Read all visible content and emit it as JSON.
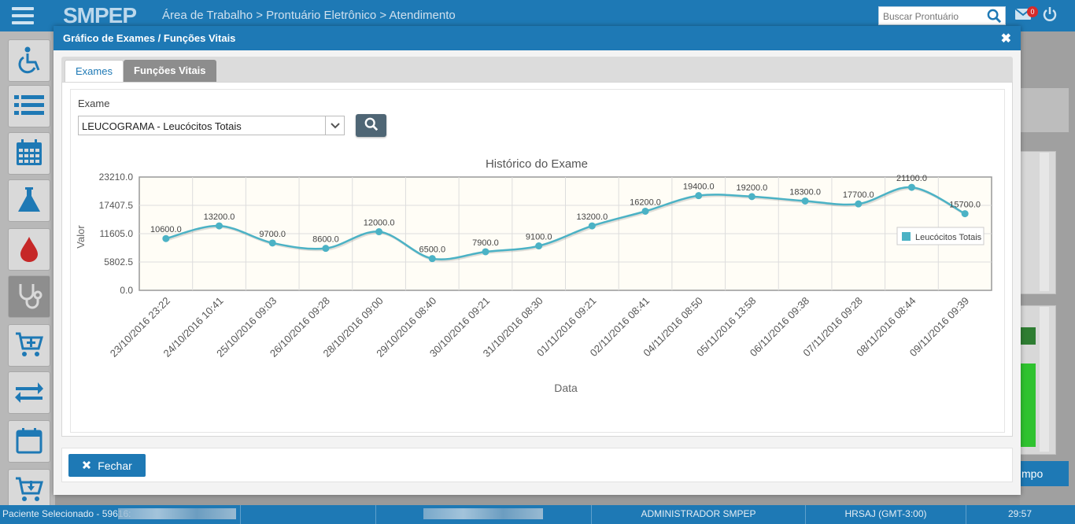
{
  "app": {
    "logo": "SMPEP",
    "breadcrumb": "Área de Trabalho > Prontuário Eletrônico > Atendimento",
    "search_placeholder": "Buscar Prontuário",
    "mail_badge": "0"
  },
  "sidebar": {
    "items": [
      {
        "icon": "accessibility-icon"
      },
      {
        "icon": "list-icon"
      },
      {
        "icon": "calendar-grid-icon"
      },
      {
        "icon": "flask-icon"
      },
      {
        "icon": "blood-drop-icon"
      },
      {
        "icon": "stethoscope-icon"
      },
      {
        "icon": "cart-add-icon"
      },
      {
        "icon": "transfer-arrows-icon"
      },
      {
        "icon": "calendar-icon"
      },
      {
        "icon": "cart-download-icon"
      }
    ]
  },
  "background": {
    "button_fragment": "mpo"
  },
  "modal": {
    "title": "Gráfico de Exames / Funções Vitais",
    "tabs": [
      {
        "label": "Exames",
        "active": true
      },
      {
        "label": "Funções Vitais",
        "active": false
      }
    ],
    "exam_label": "Exame",
    "exam_selected": "LEUCOGRAMA - Leucócitos Totais",
    "close_button": "Fechar"
  },
  "chart_data": {
    "type": "line",
    "title": "Histórico do Exame",
    "xlabel": "Data",
    "ylabel": "Valor",
    "ylim": [
      0,
      23210
    ],
    "yticks": [
      "0.0",
      "5802.5",
      "11605.0",
      "17407.5",
      "23210.0"
    ],
    "grid": true,
    "legend_position": "right",
    "categories": [
      "23/10/2016 23:22",
      "24/10/2016 10:41",
      "25/10/2016 09:03",
      "26/10/2016 09:28",
      "28/10/2016 09:00",
      "29/10/2016 08:40",
      "30/10/2016 09:21",
      "31/10/2016 08:30",
      "01/11/2016 09:21",
      "02/11/2016 08:41",
      "04/11/2016 08:50",
      "05/11/2016 13:58",
      "06/11/2016 09:38",
      "07/11/2016 09:28",
      "08/11/2016 08:44",
      "09/11/2016 09:39"
    ],
    "series": [
      {
        "name": "Leucócitos Totais",
        "color": "#4bb2c5",
        "values": [
          10600,
          13200,
          9700,
          8600,
          12000,
          6500,
          7900,
          9100,
          13200,
          16200,
          19400,
          19200,
          18300,
          17700,
          21100,
          15700
        ]
      }
    ],
    "data_labels": [
      "10600.0",
      "13200.0",
      "9700.0",
      "8600.0",
      "12000.0",
      "6500.0",
      "7900.0",
      "9100.0",
      "13200.0",
      "16200.0",
      "19400.0",
      "19200.0",
      "18300.0",
      "17700.0",
      "21100.0",
      "15700.0"
    ]
  },
  "statusbar": {
    "patient": "Paciente Selecionado - 59616:",
    "user": "ADMINISTRADOR SMPEP",
    "unit": "HRSAJ (GMT-3:00)",
    "time": "29:57"
  }
}
